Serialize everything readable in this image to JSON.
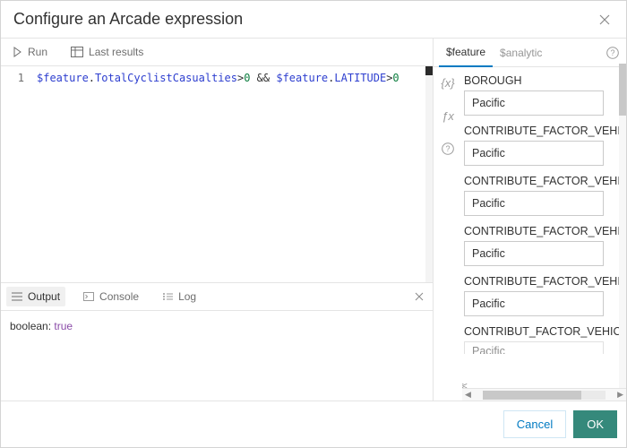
{
  "title": "Configure an Arcade expression",
  "toolbar": {
    "run_label": "Run",
    "last_results_label": "Last results"
  },
  "editor": {
    "line_number": "1",
    "tokens": {
      "var1": "$feature",
      "dot1": ".",
      "prop1": "TotalCyclistCasualties",
      "op1": ">",
      "num1": "0",
      "and": " && ",
      "var2": "$feature",
      "dot2": ".",
      "prop2": "LATITUDE",
      "op2": ">",
      "num2": "0"
    }
  },
  "tabs": {
    "output": "Output",
    "console": "Console",
    "log": "Log"
  },
  "output": {
    "type_label": "boolean: ",
    "value": "true"
  },
  "right": {
    "tab_feature": "$feature",
    "tab_analytic": "$analytic",
    "strip": {
      "vars": "{x}",
      "fx": "ƒx"
    },
    "fields": [
      {
        "name": "BOROUGH",
        "value": "Pacific"
      },
      {
        "name": "CONTRIBUTE_FACTOR_VEHICLE",
        "value": "Pacific"
      },
      {
        "name": "CONTRIBUTE_FACTOR_VEHICLE",
        "value": "Pacific"
      },
      {
        "name": "CONTRIBUTE_FACTOR_VEHICLE",
        "value": "Pacific"
      },
      {
        "name": "CONTRIBUTE_FACTOR_VEHICLE",
        "value": "Pacific"
      },
      {
        "name": "CONTRIBUT_FACTOR_VEHICLE_",
        "value": "Pacific"
      }
    ]
  },
  "footer": {
    "cancel": "Cancel",
    "ok": "OK"
  }
}
